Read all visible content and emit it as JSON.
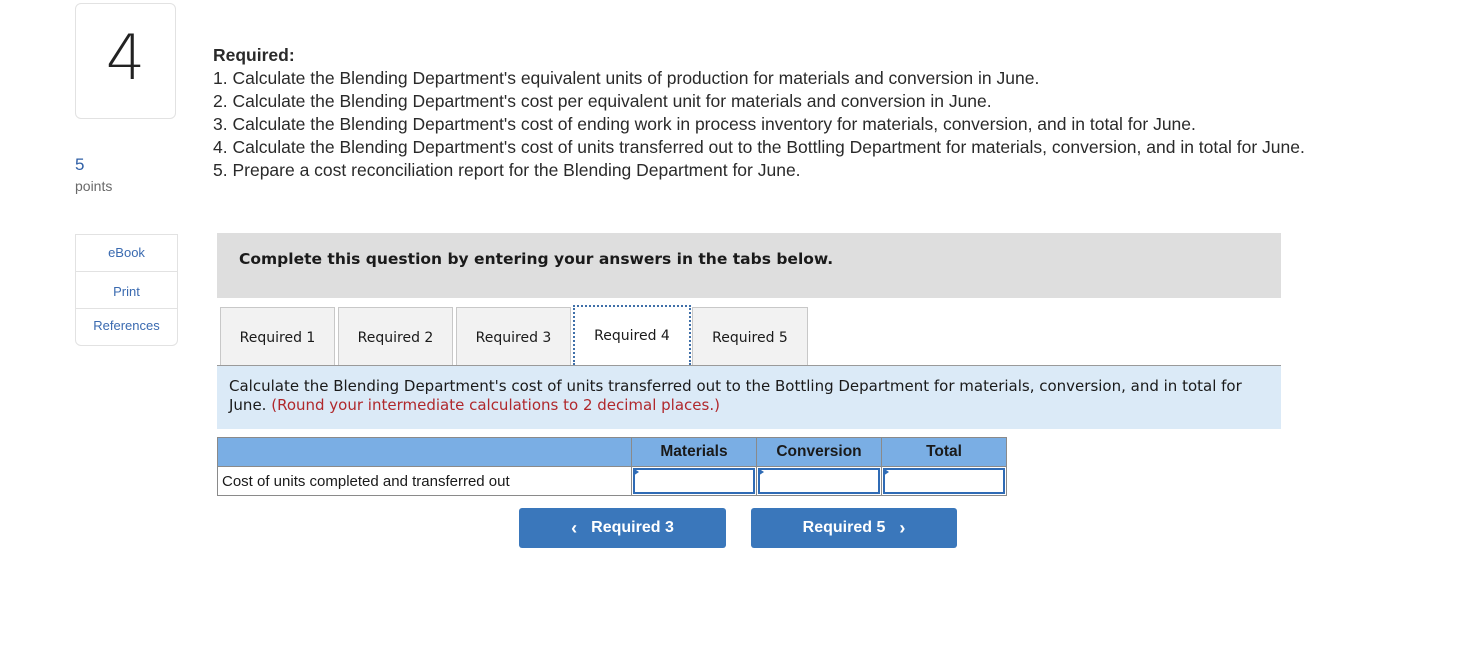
{
  "question": {
    "number": "4",
    "points_value": "5",
    "points_label": "points"
  },
  "side_links": [
    {
      "label": "eBook"
    },
    {
      "label": "Print"
    },
    {
      "label": "References"
    }
  ],
  "required": {
    "title": "Required:",
    "items": [
      "1. Calculate the Blending Department's equivalent units of production for materials and conversion in June.",
      "2. Calculate the Blending Department's cost per equivalent unit for materials and conversion in June.",
      "3. Calculate the Blending Department's cost of ending work in process inventory for materials, conversion, and in total for June.",
      "4. Calculate the Blending Department's cost of units transferred out to the Bottling Department for materials, conversion, and in total for June.",
      "5. Prepare a cost reconciliation report for the Blending Department for June."
    ]
  },
  "instruction": "Complete this question by entering your answers in the tabs below.",
  "tabs": [
    {
      "label": "Required 1",
      "active": false
    },
    {
      "label": "Required 2",
      "active": false
    },
    {
      "label": "Required 3",
      "active": false
    },
    {
      "label": "Required 4",
      "active": true
    },
    {
      "label": "Required 5",
      "active": false
    }
  ],
  "prompt": {
    "text": "Calculate the Blending Department's cost of units transferred out to the Bottling Department for materials, conversion, and in total for June.",
    "note": "(Round your intermediate calculations to 2 decimal places.)"
  },
  "table": {
    "headers": [
      "",
      "Materials",
      "Conversion",
      "Total"
    ],
    "rows": [
      {
        "label": "Cost of units completed and transferred out",
        "values": [
          "",
          "",
          ""
        ]
      }
    ]
  },
  "nav": {
    "prev_label": "Required 3",
    "next_label": "Required 5",
    "prev_icon": "chevron-left-icon",
    "next_icon": "chevron-right-icon"
  },
  "colors": {
    "accent_blue": "#3a77bb",
    "table_header": "#7aaee4",
    "prompt_bg": "#dbeaf7",
    "note_red": "#b0282c"
  }
}
